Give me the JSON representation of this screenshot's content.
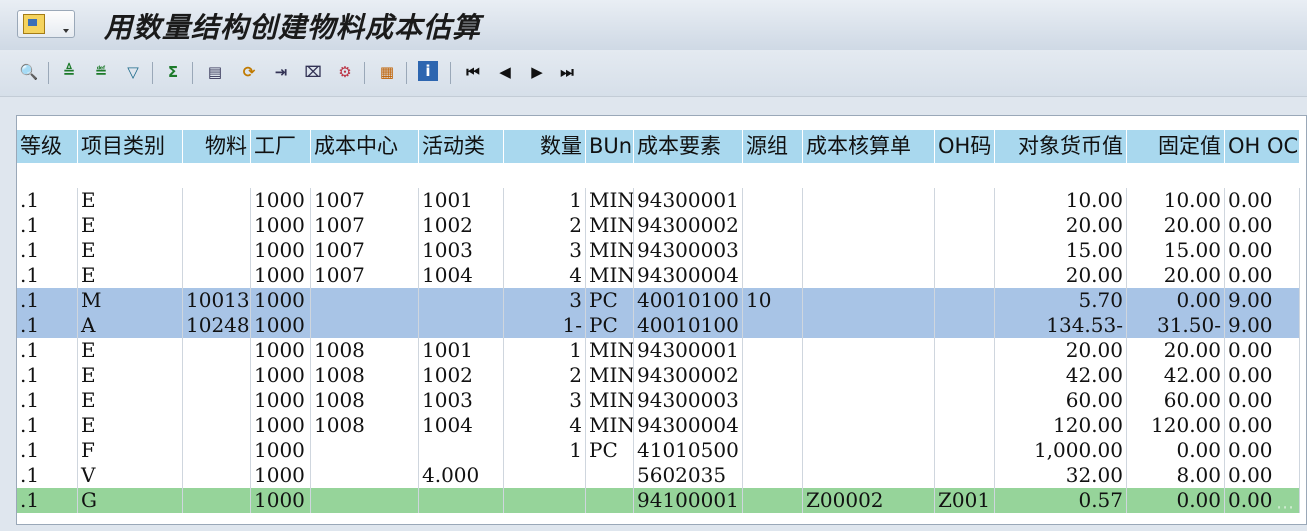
{
  "window": {
    "title": "用数量结构创建物料成本估算"
  },
  "toolbar": {
    "icons": [
      "details-icon",
      "sort-asc-icon",
      "sort-desc-icon",
      "filter-icon",
      "sum-icon",
      "export-icon",
      "change-layout-icon",
      "save-layout-icon",
      "print-icon",
      "abc-analysis-icon",
      "grid-layout-icon",
      "info-icon",
      "first-page-icon",
      "previous-page-icon",
      "next-page-icon",
      "last-page-icon"
    ]
  },
  "columns": [
    "等级",
    "项目类别",
    "物料",
    "工厂",
    "成本中心",
    "活动类",
    "数量",
    "BUn",
    "成本要素",
    "源组",
    "成本核算单",
    "OH码",
    "对象货币值",
    "固定值",
    "OH OC"
  ],
  "rows": [
    {
      "style": "white",
      "cells": [
        ".1",
        "E",
        "",
        "1000",
        "1007",
        "1001",
        "1",
        "MIN",
        "94300001",
        "",
        "",
        "",
        "10.00",
        "10.00",
        "0.00"
      ]
    },
    {
      "style": "white",
      "cells": [
        ".1",
        "E",
        "",
        "1000",
        "1007",
        "1002",
        "2",
        "MIN",
        "94300002",
        "",
        "",
        "",
        "20.00",
        "20.00",
        "0.00"
      ]
    },
    {
      "style": "white",
      "cells": [
        ".1",
        "E",
        "",
        "1000",
        "1007",
        "1003",
        "3",
        "MIN",
        "94300003",
        "",
        "",
        "",
        "15.00",
        "15.00",
        "0.00"
      ]
    },
    {
      "style": "white",
      "cells": [
        ".1",
        "E",
        "",
        "1000",
        "1007",
        "1004",
        "4",
        "MIN",
        "94300004",
        "",
        "",
        "",
        "20.00",
        "20.00",
        "0.00"
      ]
    },
    {
      "style": "blue",
      "cells": [
        ".1",
        "M",
        "10013",
        "1000",
        "",
        "",
        "3",
        "PC",
        "40010100",
        "10",
        "",
        "",
        "5.70",
        "0.00",
        "9.00"
      ]
    },
    {
      "style": "blue",
      "cells": [
        ".1",
        "A",
        "10248",
        "1000",
        "",
        "",
        "1-",
        "PC",
        "40010100",
        "",
        "",
        "",
        "134.53-",
        "31.50-",
        "9.00"
      ]
    },
    {
      "style": "white",
      "cells": [
        ".1",
        "E",
        "",
        "1000",
        "1008",
        "1001",
        "1",
        "MIN",
        "94300001",
        "",
        "",
        "",
        "20.00",
        "20.00",
        "0.00"
      ]
    },
    {
      "style": "white",
      "cells": [
        ".1",
        "E",
        "",
        "1000",
        "1008",
        "1002",
        "2",
        "MIN",
        "94300002",
        "",
        "",
        "",
        "42.00",
        "42.00",
        "0.00"
      ]
    },
    {
      "style": "white",
      "cells": [
        ".1",
        "E",
        "",
        "1000",
        "1008",
        "1003",
        "3",
        "MIN",
        "94300003",
        "",
        "",
        "",
        "60.00",
        "60.00",
        "0.00"
      ]
    },
    {
      "style": "white",
      "cells": [
        ".1",
        "E",
        "",
        "1000",
        "1008",
        "1004",
        "4",
        "MIN",
        "94300004",
        "",
        "",
        "",
        "120.00",
        "120.00",
        "0.00"
      ]
    },
    {
      "style": "white",
      "cells": [
        ".1",
        "F",
        "",
        "1000",
        "",
        "",
        "1",
        "PC",
        "41010500",
        "",
        "",
        "",
        "1,000.00",
        "0.00",
        "0.00"
      ]
    },
    {
      "style": "white",
      "cells": [
        ".1",
        "V",
        "",
        "1000",
        "",
        "4.000",
        "",
        "",
        "5602035",
        "",
        "",
        "",
        "32.00",
        "8.00",
        "0.00"
      ]
    },
    {
      "style": "green",
      "cells": [
        ".1",
        "G",
        "",
        "1000",
        "",
        "",
        "",
        "",
        "94100001",
        "",
        "Z00002",
        "Z001",
        "0.57",
        "0.00",
        "0.00"
      ]
    }
  ]
}
